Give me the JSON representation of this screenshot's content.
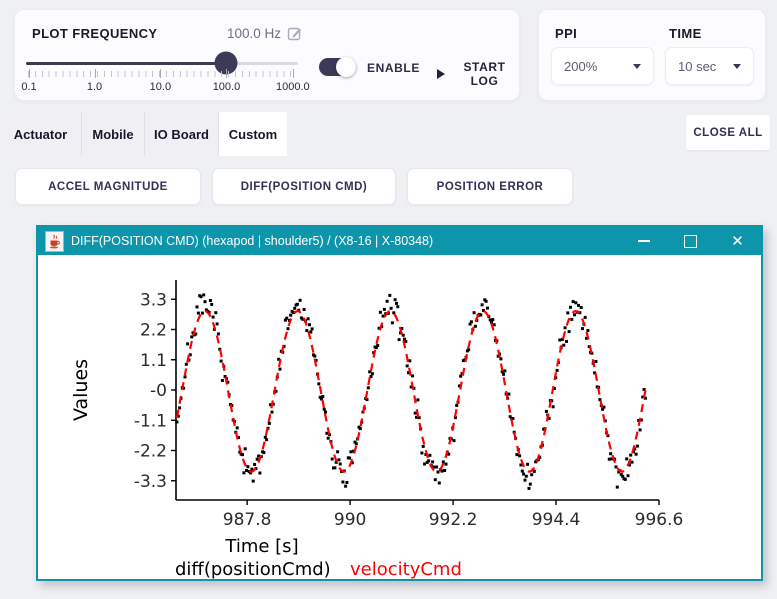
{
  "frequency_panel": {
    "title": "PLOT FREQUENCY",
    "value": "100.0 Hz",
    "slider": {
      "fill_pct": 73.7,
      "tick_labels": [
        "0.1",
        "1.0",
        "10.0",
        "100.0",
        "1000.0"
      ],
      "tick_positions_pct": [
        1.1,
        25.2,
        49.4,
        73.7,
        98.1
      ]
    },
    "enable_label": "ENABLE",
    "start_log_label": "START LOG"
  },
  "display_panel": {
    "ppi_label": "PPI",
    "ppi_value": "200%",
    "time_label": "TIME",
    "time_value": "10 sec"
  },
  "tabs": {
    "items": [
      {
        "label": "Actuator",
        "active": false
      },
      {
        "label": "Mobile",
        "active": false
      },
      {
        "label": "IO Board",
        "active": false
      },
      {
        "label": "Custom",
        "active": true
      }
    ],
    "close_all_label": "CLOSE ALL"
  },
  "plot_buttons": [
    "ACCEL MAGNITUDE",
    "DIFF(POSITION CMD)",
    "POSITION ERROR"
  ],
  "window": {
    "title": "DIFF(POSITION CMD) (hexapod | shoulder5) / (X8-16 | X-80348)",
    "titlebar_color": "#0d96ab",
    "close_glyph": "✕",
    "icon": "java-coffee-icon"
  },
  "colors": {
    "accent_dark": "#3b3b58",
    "teal": "#0d96ab",
    "series_black": "#000000",
    "series_red": "#ff0000",
    "page_bg": "#eef0f2"
  },
  "chart_data": {
    "type": "scatter",
    "title": "",
    "xlabel": "Time [s]",
    "ylabel": "Values",
    "xlim": [
      986.28,
      996.6
    ],
    "ylim": [
      -4.0,
      4.0
    ],
    "grid": false,
    "legend_position": "bottom",
    "x_ticks": [
      {
        "value": 987.8,
        "label": "987.8"
      },
      {
        "value": 990,
        "label": "990"
      },
      {
        "value": 992.2,
        "label": "992.2"
      },
      {
        "value": 994.4,
        "label": "994.4"
      },
      {
        "value": 996.6,
        "label": "996.6"
      }
    ],
    "y_ticks": [
      {
        "value": 3.3,
        "label": "3.3"
      },
      {
        "value": 2.2,
        "label": "2.2"
      },
      {
        "value": 1.1,
        "label": "1.1"
      },
      {
        "value": 0,
        "label": "-0"
      },
      {
        "value": -1.1,
        "label": "-1.1"
      },
      {
        "value": -2.2,
        "label": "-2.2"
      },
      {
        "value": -3.3,
        "label": "-3.3"
      }
    ],
    "series": [
      {
        "name": "diff(positionCmd)",
        "color": "#000000",
        "style": "scatter-square",
        "marker_size": 3,
        "model": "sine",
        "amplitude": 3.05,
        "offset": -0.05,
        "period": 1.98,
        "peak_t": 986.9,
        "noise_sigma": 0.27,
        "t_start": 986.3,
        "t_end": 996.32,
        "dt": 0.0286,
        "seed": 7
      },
      {
        "name": "velocityCmd",
        "color": "#ff0000",
        "style": "dashed-line",
        "line_width": 2.2,
        "dash": [
          8,
          6
        ],
        "model": "sine",
        "amplitude": 2.92,
        "offset": -0.05,
        "period": 1.98,
        "peak_t": 986.9,
        "noise_sigma": 0,
        "t_start": 986.3,
        "t_end": 996.32,
        "dt": 0.03,
        "seed": 0
      }
    ]
  }
}
